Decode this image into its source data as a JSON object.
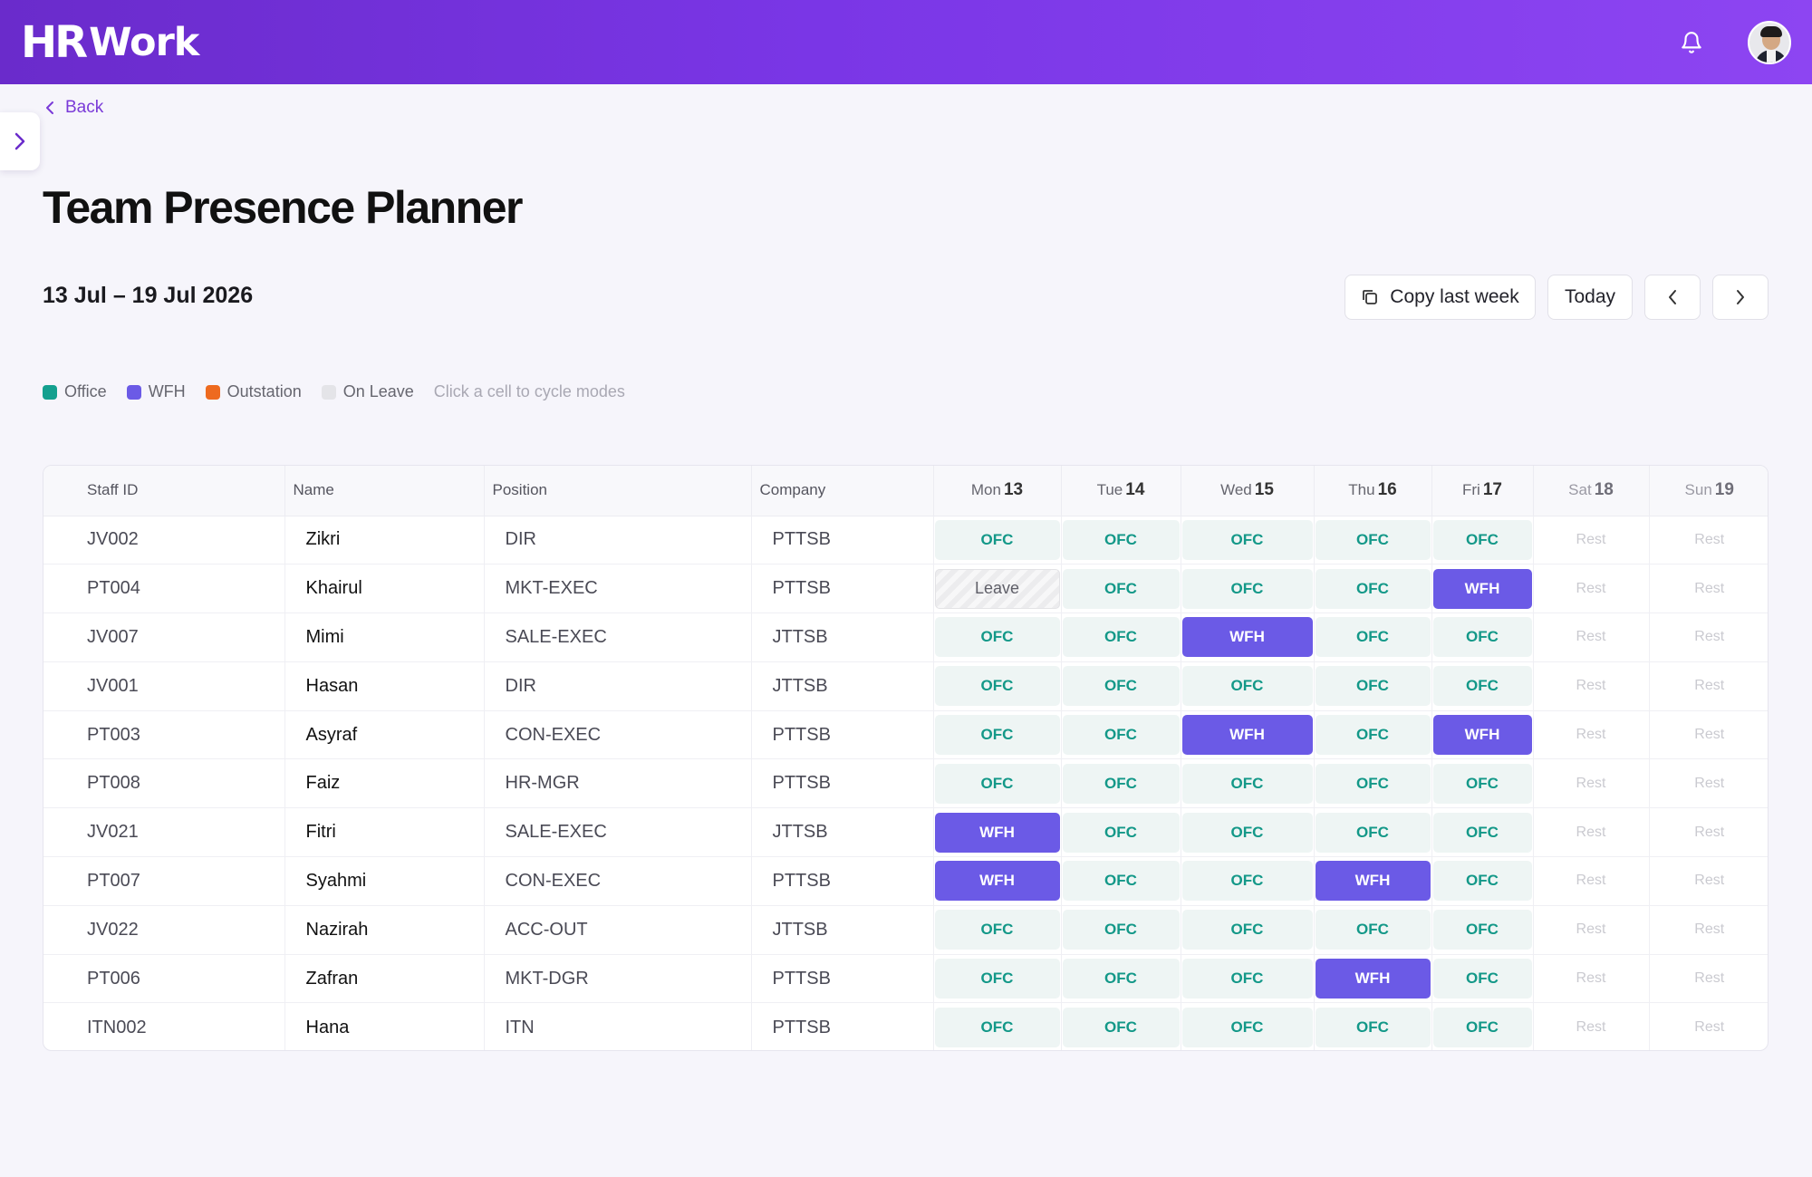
{
  "app": {
    "logo_mark": "HR",
    "logo_text": "Work"
  },
  "nav": {
    "back_label": "Back"
  },
  "page": {
    "title": "Team Presence Planner",
    "week_range": "13 Jul – 19 Jul 2026"
  },
  "actions": {
    "copy_label": "Copy last week",
    "today_label": "Today"
  },
  "legend": {
    "items": [
      {
        "label": "Office",
        "color": "#14a08f"
      },
      {
        "label": "WFH",
        "color": "#6b5ae6"
      },
      {
        "label": "Outstation",
        "color": "#ee6a1f"
      },
      {
        "label": "On Leave",
        "color": "#e4e4e8"
      }
    ],
    "hint": "Click a cell to cycle modes"
  },
  "table": {
    "headers": {
      "staff_id": "Staff ID",
      "name": "Name",
      "position": "Position",
      "company": "Company"
    },
    "days": [
      {
        "day": "Mon",
        "num": "13"
      },
      {
        "day": "Tue",
        "num": "14"
      },
      {
        "day": "Wed",
        "num": "15"
      },
      {
        "day": "Thu",
        "num": "16"
      },
      {
        "day": "Fri",
        "num": "17"
      },
      {
        "day": "Sat",
        "num": "18"
      },
      {
        "day": "Sun",
        "num": "19"
      }
    ],
    "rows": [
      {
        "id": "JV002",
        "name": "Zikri",
        "position": "DIR",
        "company": "PTTSB",
        "cells": [
          "OFC",
          "OFC",
          "OFC",
          "OFC",
          "OFC",
          "Rest",
          "Rest"
        ]
      },
      {
        "id": "PT004",
        "name": "Khairul",
        "position": "MKT-EXEC",
        "company": "PTTSB",
        "cells": [
          "Leave",
          "OFC",
          "OFC",
          "OFC",
          "WFH",
          "Rest",
          "Rest"
        ]
      },
      {
        "id": "JV007",
        "name": "Mimi",
        "position": "SALE-EXEC",
        "company": "JTTSB",
        "cells": [
          "OFC",
          "OFC",
          "WFH",
          "OFC",
          "OFC",
          "Rest",
          "Rest"
        ]
      },
      {
        "id": "JV001",
        "name": "Hasan",
        "position": "DIR",
        "company": "JTTSB",
        "cells": [
          "OFC",
          "OFC",
          "OFC",
          "OFC",
          "OFC",
          "Rest",
          "Rest"
        ]
      },
      {
        "id": "PT003",
        "name": "Asyraf",
        "position": "CON-EXEC",
        "company": "PTTSB",
        "cells": [
          "OFC",
          "OFC",
          "WFH",
          "OFC",
          "WFH",
          "Rest",
          "Rest"
        ]
      },
      {
        "id": "PT008",
        "name": "Faiz",
        "position": "HR-MGR",
        "company": "PTTSB",
        "cells": [
          "OFC",
          "OFC",
          "OFC",
          "OFC",
          "OFC",
          "Rest",
          "Rest"
        ]
      },
      {
        "id": "JV021",
        "name": "Fitri",
        "position": "SALE-EXEC",
        "company": "JTTSB",
        "cells": [
          "WFH",
          "OFC",
          "OFC",
          "OFC",
          "OFC",
          "Rest",
          "Rest"
        ]
      },
      {
        "id": "PT007",
        "name": "Syahmi",
        "position": "CON-EXEC",
        "company": "PTTSB",
        "cells": [
          "WFH",
          "OFC",
          "OFC",
          "WFH",
          "OFC",
          "Rest",
          "Rest"
        ]
      },
      {
        "id": "JV022",
        "name": "Nazirah",
        "position": "ACC-OUT",
        "company": "JTTSB",
        "cells": [
          "OFC",
          "OFC",
          "OFC",
          "OFC",
          "OFC",
          "Rest",
          "Rest"
        ]
      },
      {
        "id": "PT006",
        "name": "Zafran",
        "position": "MKT-DGR",
        "company": "PTTSB",
        "cells": [
          "OFC",
          "OFC",
          "OFC",
          "WFH",
          "OFC",
          "Rest",
          "Rest"
        ]
      },
      {
        "id": "ITN002",
        "name": "Hana",
        "position": "ITN",
        "company": "PTTSB",
        "cells": [
          "OFC",
          "OFC",
          "OFC",
          "OFC",
          "OFC",
          "Rest",
          "Rest"
        ]
      }
    ]
  },
  "icons": {
    "bell": "bell-icon",
    "avatar": "user-avatar",
    "sidebar_toggle": "chevron-right-icon",
    "back": "chevron-left-icon",
    "copy": "copy-icon",
    "prev": "chevron-left-icon",
    "next": "chevron-right-icon"
  }
}
